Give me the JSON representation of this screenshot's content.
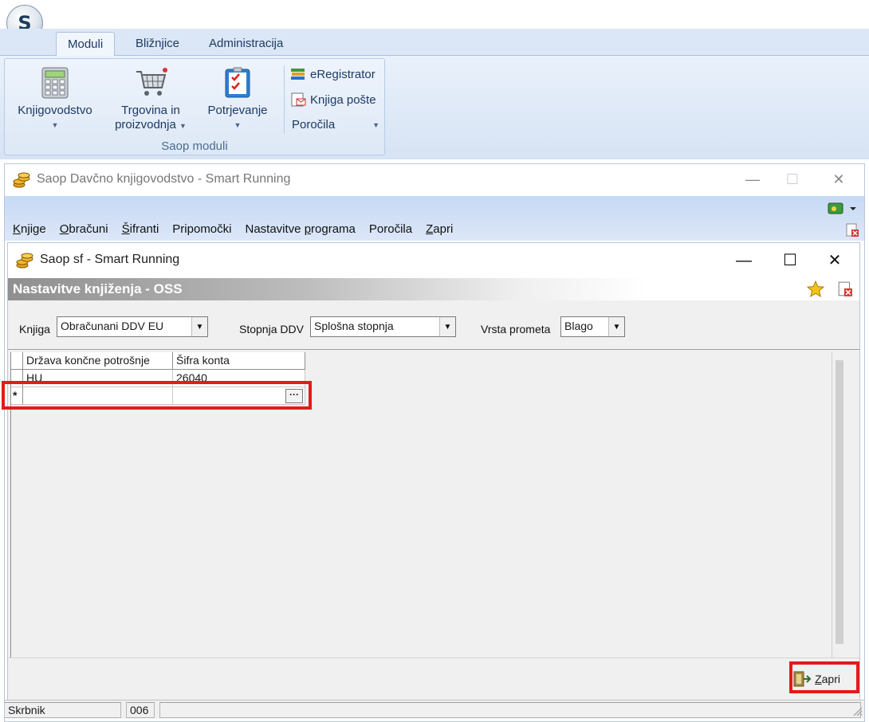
{
  "ribbon": {
    "logo": "S",
    "tabs": [
      "Moduli",
      "Bližnjice",
      "Administracija"
    ],
    "buttons": [
      {
        "label": "Knjigovodstvo",
        "icon": "calculator-icon"
      },
      {
        "label": "Trgovina in proizvodnja",
        "icon": "shopping-cart-icon"
      },
      {
        "label": "Potrjevanje",
        "icon": "checklist-icon"
      }
    ],
    "small_buttons": [
      {
        "label": "eRegistrator",
        "icon": "books-icon"
      },
      {
        "label": "Knjiga pošte",
        "icon": "mail-book-icon"
      },
      {
        "label": "Poročila",
        "icon": ""
      }
    ],
    "group_label": "Saop moduli"
  },
  "outer_window": {
    "title": "Saop Davčno knjigovodstvo - Smart Running",
    "menu": [
      {
        "ul": "K",
        "rest": "njige"
      },
      {
        "ul": "O",
        "rest": "bračuni"
      },
      {
        "ul": "Š",
        "rest": "ifranti"
      },
      {
        "ul": "",
        "rest": "Pripomočki"
      },
      {
        "ul": "",
        "rest": "Nastavitve ",
        "ul2": "p",
        "rest2": "rograma"
      },
      {
        "ul": "",
        "rest": "Poročila"
      },
      {
        "ul": "Z",
        "rest": "apri"
      }
    ]
  },
  "inner_window": {
    "title": "Saop sf - Smart Running",
    "header": "Nastavitve knjiženja - OSS",
    "filters": {
      "knjiga_label": "Knjiga",
      "knjiga_value": "Obračunani DDV EU",
      "stopnja_label": "Stopnja DDV",
      "stopnja_value": "Splošna stopnja",
      "vrsta_label": "Vrsta prometa",
      "vrsta_value": "Blago"
    },
    "grid": {
      "columns": [
        "Država končne potrošnje",
        "Šifra konta"
      ],
      "rows": [
        {
          "drzava": "HU",
          "konto": "26040"
        }
      ],
      "new_row_marker": "*",
      "ellipsis": "···"
    },
    "close_button": {
      "ul": "Z",
      "rest": "apri"
    },
    "status": [
      "Skrbnik",
      "006",
      ""
    ]
  },
  "colors": {
    "highlight": "#e21b1b",
    "ribbon_bg": "#dbe7f6",
    "outer_band": "#c7d9f5"
  }
}
